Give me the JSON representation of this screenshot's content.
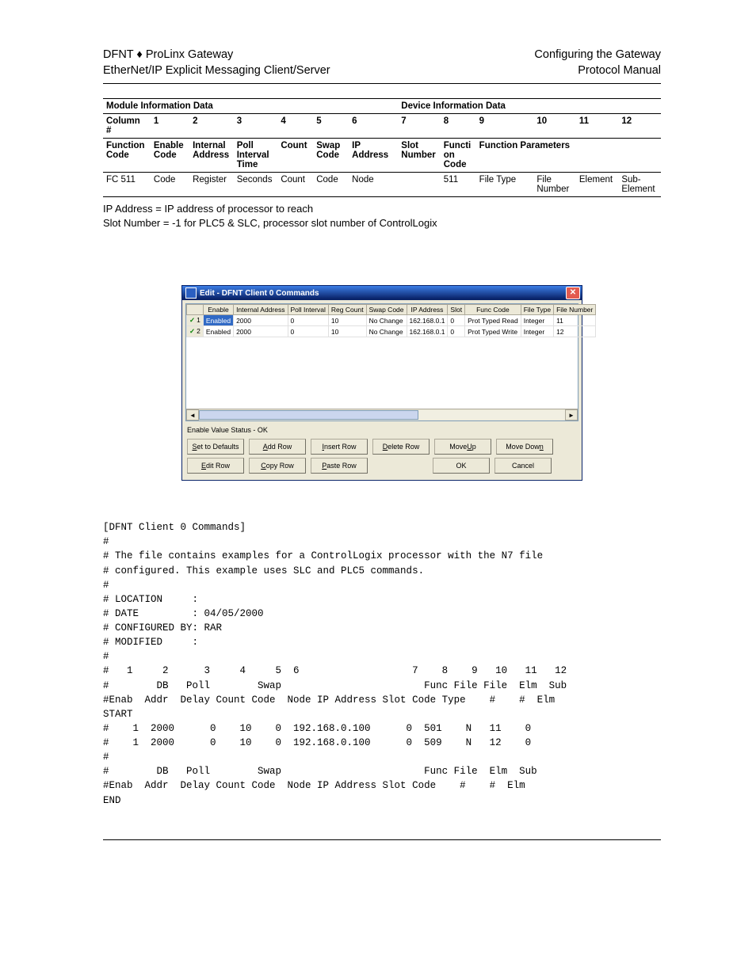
{
  "header": {
    "left1": "DFNT ♦ ProLinx Gateway",
    "left2": "EtherNet/IP Explicit Messaging Client/Server",
    "right1": "Configuring the Gateway",
    "right2": "Protocol Manual"
  },
  "info_table": {
    "section_module": "Module Information Data",
    "section_device": "Device Information Data",
    "column_label": "Column #",
    "columns": [
      "1",
      "2",
      "3",
      "4",
      "5",
      "6",
      "7",
      "8",
      "9",
      "10",
      "11",
      "12"
    ],
    "func_label": "Function Code",
    "func_headers": [
      "Enable Code",
      "Internal Address",
      "Poll Interval Time",
      "Count",
      "Swap Code",
      "IP Address",
      "Slot Number",
      "Function Code",
      "Function Parameters",
      "",
      "",
      ""
    ],
    "row_label": "FC 511",
    "row_vals": [
      "Code",
      "Register",
      "Seconds",
      "Count",
      "Code",
      "Node",
      "",
      "511",
      "File Type",
      "File Number",
      "Element",
      "Sub-Element"
    ]
  },
  "notes": {
    "line1": "IP Address = IP address of processor to reach",
    "line2": "Slot Number = -1 for PLC5 & SLC, processor slot number of ControlLogix"
  },
  "window": {
    "title": "Edit - DFNT Client 0 Commands",
    "headers": [
      "",
      "Enable",
      "Internal Address",
      "Poll Interval",
      "Reg Count",
      "Swap Code",
      "IP Address",
      "Slot",
      "Func Code",
      "File Type",
      "File Number"
    ],
    "rows": [
      {
        "n": "1",
        "enable": "Enabled",
        "addr": "2000",
        "poll": "0",
        "reg": "10",
        "swap": "No Change",
        "ip": "162.168.0.1",
        "slot": "0",
        "func": "Prot Typed Read",
        "ftype": "Integer",
        "fnum": "11",
        "selected": true
      },
      {
        "n": "2",
        "enable": "Enabled",
        "addr": "2000",
        "poll": "0",
        "reg": "10",
        "swap": "No Change",
        "ip": "162.168.0.1",
        "slot": "0",
        "func": "Prot Typed Write",
        "ftype": "Integer",
        "fnum": "12",
        "selected": false
      }
    ],
    "status": "Enable Value Status - OK",
    "buttons_row1": [
      {
        "pre": "",
        "u": "S",
        "post": "et to Defaults"
      },
      {
        "pre": "",
        "u": "A",
        "post": "dd Row"
      },
      {
        "pre": "",
        "u": "I",
        "post": "nsert Row"
      },
      {
        "pre": "",
        "u": "D",
        "post": "elete Row"
      },
      {
        "pre": "Move ",
        "u": "U",
        "post": "p"
      },
      {
        "pre": "Move Dow",
        "u": "n",
        "post": ""
      }
    ],
    "buttons_row2": [
      {
        "pre": "",
        "u": "E",
        "post": "dit Row"
      },
      {
        "pre": "",
        "u": "C",
        "post": "opy Row"
      },
      {
        "pre": "",
        "u": "P",
        "post": "aste Row"
      },
      {
        "blank": true
      },
      {
        "pre": "OK",
        "u": "",
        "post": ""
      },
      {
        "pre": "Cancel",
        "u": "",
        "post": ""
      }
    ]
  },
  "code": "[DFNT Client 0 Commands]\n#\n# The file contains examples for a ControlLogix processor with the N7 file\n# configured. This example uses SLC and PLC5 commands.\n#\n# LOCATION     :\n# DATE         : 04/05/2000\n# CONFIGURED BY: RAR\n# MODIFIED     :\n#\n#   1     2      3     4     5  6                   7    8    9   10   11   12\n#        DB   Poll        Swap                        Func File File  Elm  Sub\n#Enab  Addr  Delay Count Code  Node IP Address Slot Code Type    #    #  Elm\nSTART\n#    1  2000      0    10    0  192.168.0.100      0  501    N   11    0\n#    1  2000      0    10    0  192.168.0.100      0  509    N   12    0\n#\n#        DB   Poll        Swap                        Func File  Elm  Sub\n#Enab  Addr  Delay Count Code  Node IP Address Slot Code    #    #  Elm\nEND"
}
